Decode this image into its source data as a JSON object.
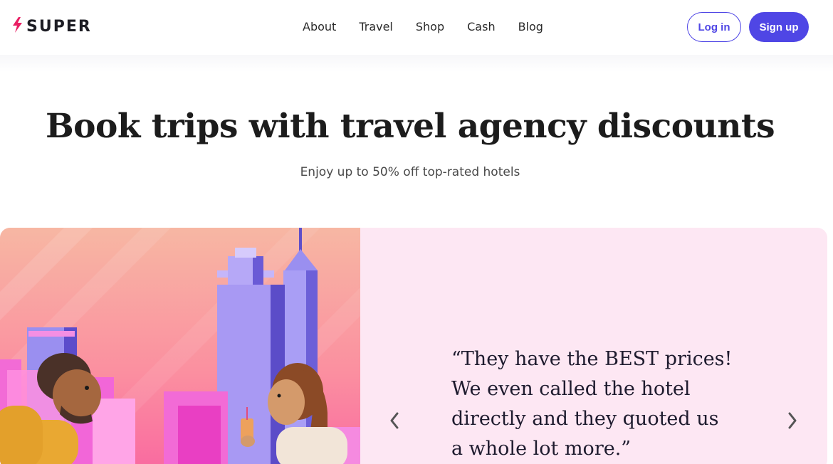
{
  "brand": {
    "name": "SUPER",
    "icon": "lightning-bolt-icon",
    "icon_color": "#e91e63"
  },
  "nav": {
    "items": [
      {
        "label": "About"
      },
      {
        "label": "Travel"
      },
      {
        "label": "Shop"
      },
      {
        "label": "Cash"
      },
      {
        "label": "Blog"
      }
    ]
  },
  "auth": {
    "login_label": "Log in",
    "signup_label": "Sign up",
    "accent": "#4f46e5"
  },
  "hero": {
    "title": "Book trips with travel agency discounts",
    "subtitle": "Enjoy up to 50% off top-rated hotels"
  },
  "testimonial": {
    "quote_lines": [
      "“They have the BEST prices!",
      "We even called the hotel",
      "directly and they quoted us",
      "a whole lot more.”"
    ],
    "background": "#fde7f3",
    "prev_icon": "chevron-left-icon",
    "next_icon": "chevron-right-icon"
  }
}
